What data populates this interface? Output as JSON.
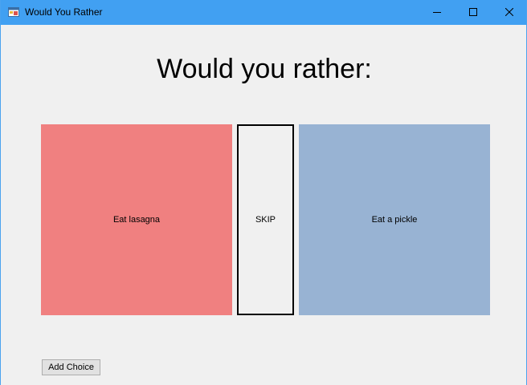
{
  "window": {
    "title": "Would You Rather",
    "icon": "winforms-app-icon",
    "controls": {
      "minimize": "minimize-icon",
      "maximize": "maximize-icon",
      "close": "close-icon"
    }
  },
  "main": {
    "heading": "Would you rather:",
    "choice_left": {
      "label": "Eat lasagna",
      "color": "#f08080"
    },
    "skip": {
      "label": "SKIP"
    },
    "choice_right": {
      "label": "Eat a pickle",
      "color": "#98b3d3"
    },
    "add_choice_label": "Add Choice"
  },
  "colors": {
    "titlebar": "#41a0f2",
    "background": "#f0f0f0"
  }
}
